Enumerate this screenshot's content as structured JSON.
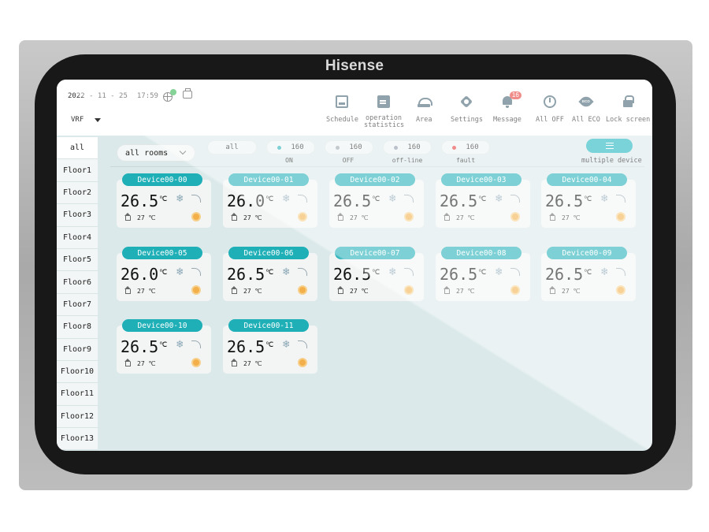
{
  "brand": "Hisense",
  "header": {
    "date": "2022 - 11 - 25",
    "time": "17:59",
    "system_selector": "VRF"
  },
  "toolbar": {
    "schedule": "Schedule",
    "operation_statistics": "operation statistics",
    "area": "Area",
    "settings": "Settings",
    "message": "Message",
    "message_badge": "16",
    "all_off": "All OFF",
    "all_eco": "All ECO",
    "lock_screen": "Lock screen"
  },
  "sidebar": {
    "items": [
      "all",
      "Floor1",
      "Floor2",
      "Floor3",
      "Floor4",
      "Floor5",
      "Floor6",
      "Floor7",
      "Floor8",
      "Floor9",
      "Floor10",
      "Floor11",
      "Floor12",
      "Floor13"
    ],
    "selected": "all"
  },
  "filters": {
    "rooms": "all rooms",
    "all": "all",
    "on": {
      "count": "160",
      "label": "ON",
      "color": "#1fafb7"
    },
    "off": {
      "count": "160",
      "label": "OFF",
      "color": "#9aa3a8"
    },
    "offline": {
      "count": "160",
      "label": "off-line",
      "color": "#8a96a8"
    },
    "fault": {
      "count": "160",
      "label": "fault",
      "color": "#e53935"
    },
    "multiple_device": "multiple device"
  },
  "temp_unit": "℃",
  "devices": [
    {
      "name": "Device00-00",
      "temp": "26.5",
      "set_temp": "27 ℃"
    },
    {
      "name": "Device00-01",
      "temp": "26.0",
      "set_temp": "27 ℃"
    },
    {
      "name": "Device00-02",
      "temp": "26.5",
      "set_temp": "27 ℃"
    },
    {
      "name": "Device00-03",
      "temp": "26.5",
      "set_temp": "27 ℃"
    },
    {
      "name": "Device00-04",
      "temp": "26.5",
      "set_temp": "27 ℃"
    },
    {
      "name": "Device00-05",
      "temp": "26.0",
      "set_temp": "27 ℃"
    },
    {
      "name": "Device00-06",
      "temp": "26.5",
      "set_temp": "27 ℃"
    },
    {
      "name": "Device00-07",
      "temp": "26.5",
      "set_temp": "27 ℃"
    },
    {
      "name": "Device00-08",
      "temp": "26.5",
      "set_temp": "27 ℃"
    },
    {
      "name": "Device00-09",
      "temp": "26.5",
      "set_temp": "27 ℃"
    },
    {
      "name": "Device00-10",
      "temp": "26.5",
      "set_temp": "27 ℃"
    },
    {
      "name": "Device00-11",
      "temp": "26.5",
      "set_temp": "27 ℃"
    }
  ],
  "colors": {
    "accent": "#1fafb7",
    "fan_indicator": "#f3b04a",
    "badge": "#e53935",
    "online_check": "#2db34a"
  }
}
